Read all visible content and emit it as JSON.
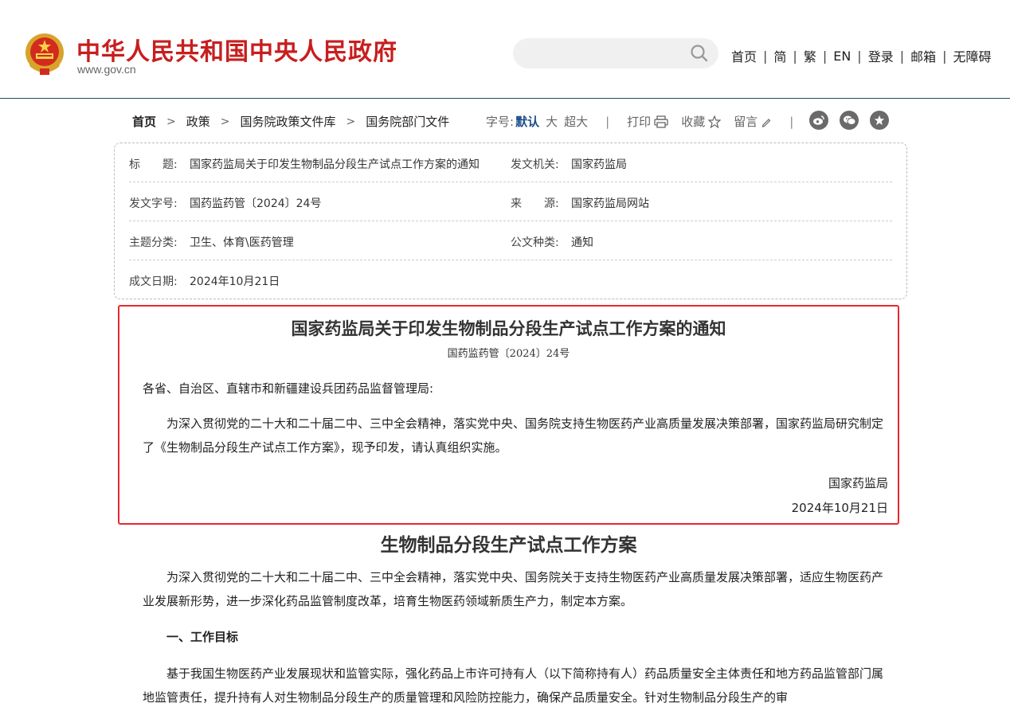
{
  "header": {
    "site_title": "中华人民共和国中央人民政府",
    "site_domain": "www.gov.cn",
    "search_placeholder": "",
    "nav": [
      "首页",
      "简",
      "繁",
      "EN",
      "登录",
      "邮箱",
      "无障碍"
    ],
    "colors": {
      "brand_red": "#c81e1e",
      "rule": "#1d4e5e"
    }
  },
  "breadcrumb": [
    "首页",
    "政策",
    "国务院政策文件库",
    "国务院部门文件"
  ],
  "tools": {
    "font_size_label": "字号:",
    "font_default": "默认",
    "font_large": "大",
    "font_xlarge": "超大",
    "print": "打印",
    "favorite": "收藏",
    "comment": "留言",
    "share_icons": [
      "weibo-icon",
      "wechat-icon",
      "star-circle-icon"
    ]
  },
  "meta": {
    "title_key": "标　　题:",
    "title_val": "国家药监局关于印发生物制品分段生产试点工作方案的通知",
    "issuer_key": "发文机关:",
    "issuer_val": "国家药监局",
    "docno_key": "发文字号:",
    "docno_val": "国药监药管〔2024〕24号",
    "source_key": "来　　源:",
    "source_val": "国家药监局网站",
    "topic_key": "主题分类:",
    "topic_val": "卫生、体育\\医药管理",
    "type_key": "公文种类:",
    "type_val": "通知",
    "date_key": "成文日期:",
    "date_val": "2024年10月21日"
  },
  "notice": {
    "title": "国家药监局关于印发生物制品分段生产试点工作方案的通知",
    "doc_no": "国药监药管〔2024〕24号",
    "addressee": "各省、自治区、直辖市和新疆建设兵团药品监督管理局:",
    "body": "为深入贯彻党的二十大和二十届二中、三中全会精神，落实党中央、国务院支持生物医药产业高质量发展决策部署，国家药监局研究制定了《生物制品分段生产试点工作方案》，现予印发，请认真组织实施。",
    "signer": "国家药监局",
    "date": "2024年10月21日",
    "highlight_color": "#e8272e"
  },
  "plan": {
    "title": "生物制品分段生产试点工作方案",
    "intro": "为深入贯彻党的二十大和二十届二中、三中全会精神，落实党中央、国务院关于支持生物医药产业高质量发展决策部署，适应生物医药产业发展新形势，进一步深化药品监管制度改革，培育生物医药领域新质生产力，制定本方案。",
    "section1_heading": "一、工作目标",
    "section1_body": "基于我国生物医药产业发展现状和监管实际，强化药品上市许可持有人（以下简称持有人）药品质量安全主体责任和地方药品监管部门属地监管责任，提升持有人对生物制品分段生产的质量管理和风险防控能力，确保产品质量安全。针对生物制品分段生产的审"
  }
}
